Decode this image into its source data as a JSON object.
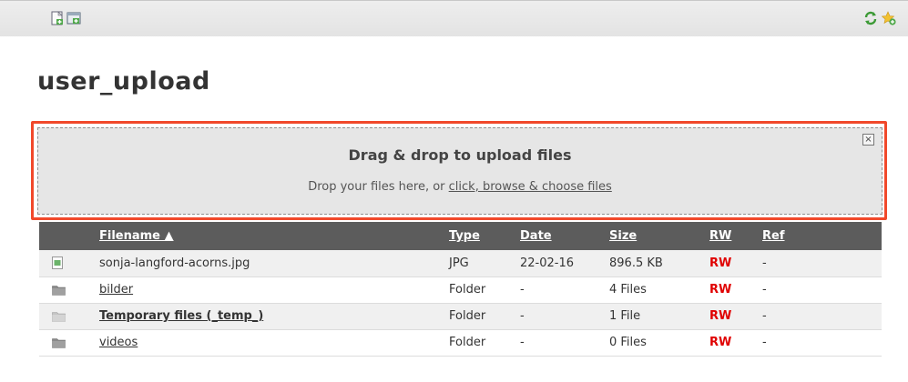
{
  "page": {
    "title": "user_upload"
  },
  "toolbar": {
    "icons_left": [
      "new-file-icon",
      "new-folder-icon"
    ],
    "icons_right": [
      "refresh-icon",
      "add-bookmark-icon"
    ]
  },
  "dropzone": {
    "title": "Drag & drop to upload files",
    "sub_prefix": "Drop your files here, or ",
    "sub_link": "click, browse & choose files",
    "close_label": "×"
  },
  "table": {
    "headers": {
      "filename": "Filename ▲",
      "type": "Type",
      "date": "Date",
      "size": "Size",
      "rw": "RW",
      "ref": "Ref"
    },
    "rows": [
      {
        "icon": "image-file-icon",
        "name": "sonja-langford-acorns.jpg",
        "type": "JPG",
        "date": "22-02-16",
        "size": "896.5 KB",
        "rw": "RW",
        "ref": "-"
      },
      {
        "icon": "folder-icon",
        "name": "bilder",
        "type": "Folder",
        "date": "-",
        "size": "4 Files",
        "rw": "RW",
        "ref": "-"
      },
      {
        "icon": "temp-folder-icon",
        "name": "Temporary files (_temp_)",
        "type": "Folder",
        "date": "-",
        "size": "1 File",
        "rw": "RW",
        "ref": "-"
      },
      {
        "icon": "folder-icon",
        "name": "videos",
        "type": "Folder",
        "date": "-",
        "size": "0 Files",
        "rw": "RW",
        "ref": "-"
      }
    ]
  },
  "colors": {
    "accent_outline": "#f1492b",
    "header_bg": "#5c5c5c",
    "rw": "#e00000"
  }
}
